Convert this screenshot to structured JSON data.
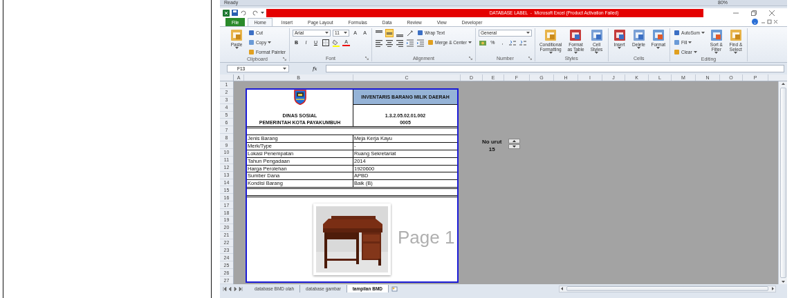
{
  "status_strip": {
    "text": "Ready",
    "zoom": "80%"
  },
  "title_bar": {
    "title": "DATABASE LABEL  -  Microsoft Excel (Product Activation Failed)"
  },
  "ribbon_tabs": [
    {
      "label": "File",
      "kind": "file",
      "selected": false
    },
    {
      "label": "Home",
      "kind": "tab",
      "selected": true
    },
    {
      "label": "Insert",
      "kind": "tab",
      "selected": false
    },
    {
      "label": "Page Layout",
      "kind": "tab",
      "selected": false
    },
    {
      "label": "Formulas",
      "kind": "tab",
      "selected": false
    },
    {
      "label": "Data",
      "kind": "tab",
      "selected": false
    },
    {
      "label": "Review",
      "kind": "tab",
      "selected": false
    },
    {
      "label": "View",
      "kind": "tab",
      "selected": false
    },
    {
      "label": "Developer",
      "kind": "tab",
      "selected": false
    }
  ],
  "ribbon_groups": [
    {
      "name": "Clipboard",
      "launcher": true,
      "items": [
        {
          "kind": "large",
          "lines": [
            "Paste"
          ],
          "caret": true
        },
        {
          "kind": "stack",
          "rows": [
            [
              {
                "kind": "small",
                "label": "Cut",
                "caret": false
              }
            ],
            [
              {
                "kind": "small",
                "label": "Copy",
                "caret": true
              }
            ],
            [
              {
                "kind": "small",
                "label": "Format Painter",
                "caret": false
              }
            ]
          ]
        }
      ]
    },
    {
      "name": "Font",
      "launcher": true,
      "items": [
        {
          "kind": "stack",
          "rows": [
            [
              {
                "kind": "field",
                "value": "Arial"
              },
              {
                "kind": "field",
                "value": "11"
              },
              {
                "kind": "glyph",
                "label": "A"
              },
              {
                "kind": "glyph",
                "label": "A"
              }
            ],
            [
              {
                "kind": "glyph",
                "label": "B"
              },
              {
                "kind": "glyph",
                "label": "I"
              },
              {
                "kind": "glyph",
                "label": "U"
              },
              {
                "kind": "borders"
              },
              {
                "kind": "fill-color"
              },
              {
                "kind": "font-color",
                "label": "A"
              }
            ]
          ]
        }
      ]
    },
    {
      "name": "Alignment",
      "launcher": true,
      "items": [
        {
          "kind": "stack",
          "rows": [
            [
              {
                "kind": "align-top",
                "selected": false
              },
              {
                "kind": "align-middle",
                "selected": true
              },
              {
                "kind": "align-bottom",
                "selected": false
              },
              {
                "kind": "orientation"
              },
              {
                "kind": "small",
                "label": "Wrap Text",
                "caret": false
              }
            ],
            [
              {
                "kind": "align-left",
                "selected": false
              },
              {
                "kind": "align-center",
                "selected": false
              },
              {
                "kind": "align-right",
                "selected": false
              },
              {
                "kind": "indent"
              },
              {
                "kind": "indent"
              },
              {
                "kind": "small",
                "label": "Merge & Center",
                "caret": true
              }
            ]
          ]
        }
      ]
    },
    {
      "name": "Number",
      "launcher": true,
      "items": [
        {
          "kind": "stack",
          "rows": [
            [
              {
                "kind": "field",
                "value": "General"
              }
            ],
            [
              {
                "kind": "currency"
              },
              {
                "kind": "glyph",
                "label": "%"
              },
              {
                "kind": "glyph",
                "label": ","
              },
              {
                "kind": "decimal"
              },
              {
                "kind": "decimal"
              }
            ]
          ]
        }
      ]
    },
    {
      "name": "Styles",
      "launcher": false,
      "items": [
        {
          "kind": "large",
          "lines": [
            "Conditional",
            "Formatting"
          ],
          "caret": true
        },
        {
          "kind": "large",
          "lines": [
            "Format",
            "as Table"
          ],
          "caret": true
        },
        {
          "kind": "large",
          "lines": [
            "Cell",
            "Styles"
          ],
          "caret": true
        }
      ]
    },
    {
      "name": "Cells",
      "launcher": false,
      "items": [
        {
          "kind": "large",
          "lines": [
            "Insert"
          ],
          "caret": true
        },
        {
          "kind": "large",
          "lines": [
            "Delete"
          ],
          "caret": true
        },
        {
          "kind": "large",
          "lines": [
            "Format"
          ],
          "caret": true
        }
      ]
    },
    {
      "name": "Editing",
      "launcher": false,
      "items": [
        {
          "kind": "stack",
          "rows": [
            [
              {
                "kind": "small",
                "label": "AutoSum",
                "caret": true
              }
            ],
            [
              {
                "kind": "small",
                "label": "Fill",
                "caret": true
              }
            ],
            [
              {
                "kind": "small",
                "label": "Clear",
                "caret": true
              }
            ]
          ]
        },
        {
          "kind": "large",
          "lines": [
            "Sort &",
            "Filter"
          ],
          "caret": true
        },
        {
          "kind": "large",
          "lines": [
            "Find &",
            "Select"
          ],
          "caret": true
        }
      ]
    }
  ],
  "formula_bar": {
    "name_box": "F13",
    "function_label": "fx"
  },
  "columns": [
    "A",
    "B",
    "C",
    "D",
    "E",
    "F",
    "G",
    "H",
    "I",
    "J",
    "K",
    "L",
    "M",
    "N",
    "O",
    "P"
  ],
  "rows": [
    "1",
    "2",
    "3",
    "4",
    "5",
    "6",
    "7",
    "8",
    "9",
    "10",
    "11",
    "12",
    "13",
    "14",
    "15",
    "16",
    "17",
    "18",
    "19",
    "20",
    "21",
    "22",
    "23",
    "24",
    "25",
    "26",
    "27"
  ],
  "form": {
    "agency": "DINAS SOSIAL",
    "government": "PEMERINTAH KOTA PAYAKUMBUH",
    "title": "INVENTARIS BARANG MILIK DAERAH",
    "code": "1.3.2.05.02.01.002",
    "number": "0005",
    "fields": [
      {
        "label": "Jenis Barang",
        "value": "Meja Kerja Kayu"
      },
      {
        "label": "Merk/Type",
        "value": "-"
      },
      {
        "label": "Lokasi Penempatan",
        "value": "Ruang Sekretariat"
      },
      {
        "label": "Tahun Pengadaan",
        "value": "2014"
      },
      {
        "label": "Harga Perolehan",
        "value": "1920600"
      },
      {
        "label": "Sumber Dana",
        "value": "APBD"
      },
      {
        "label": "Kondisi Barang",
        "value": "Baik (B)"
      }
    ]
  },
  "page_watermark": "Page 1",
  "counter": {
    "label": "No urut",
    "value": "15"
  },
  "sheet_tabs": [
    {
      "label": "database BMD olah",
      "selected": false
    },
    {
      "label": "database gambar",
      "selected": false
    },
    {
      "label": "tampilan BMD",
      "selected": true
    }
  ]
}
